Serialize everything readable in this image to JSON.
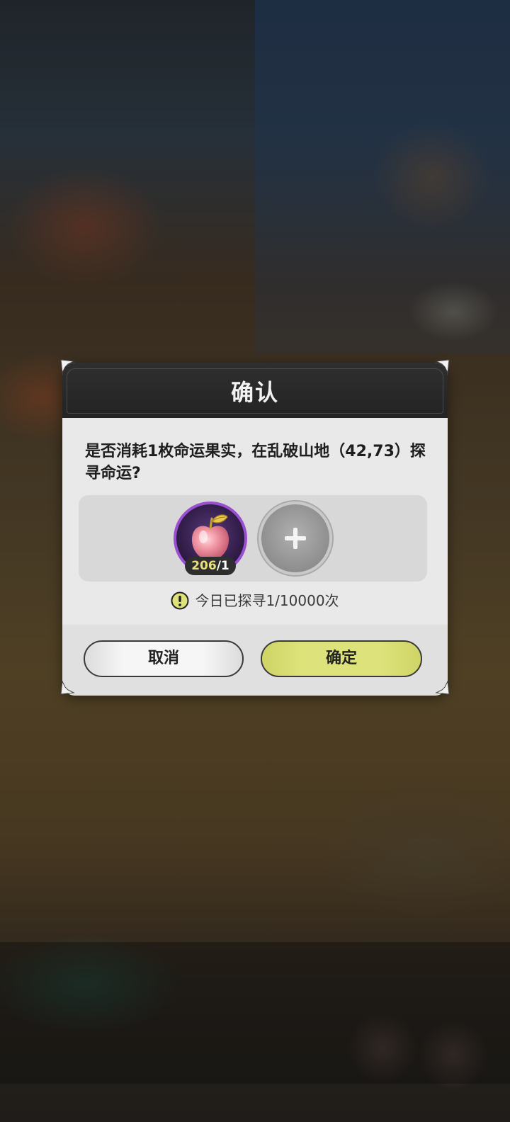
{
  "dialog": {
    "title": "确认",
    "message": "是否消耗1枚命运果实，在乱破山地（42,73）探寻命运?",
    "item": {
      "name": "命运果实",
      "icon": "apple-icon",
      "owned": "206",
      "required": "/1",
      "frame_color": "#9a4fd0"
    },
    "add_slot_icon": "plus-icon",
    "daily_info": "今日已探寻1/10000次",
    "buttons": {
      "cancel": "取消",
      "confirm": "确定"
    },
    "colors": {
      "header": "#262626",
      "body": "#e9e9e9",
      "confirm": "#dde27a",
      "warning": "#dde27a"
    }
  }
}
